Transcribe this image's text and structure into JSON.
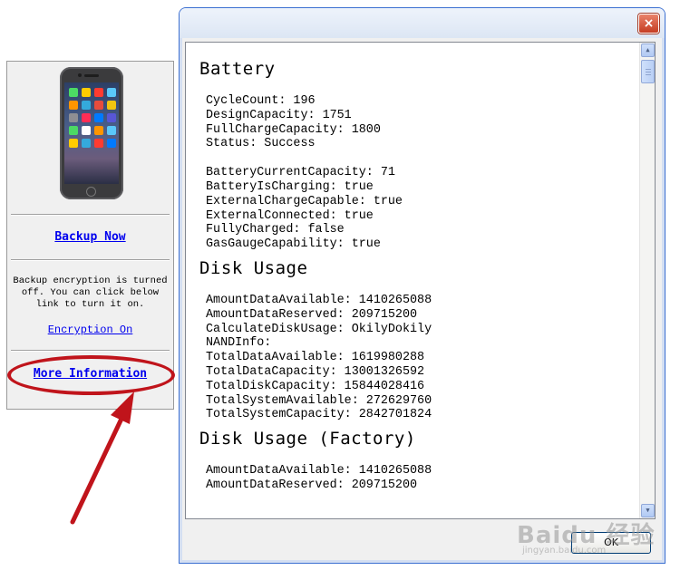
{
  "side_panel": {
    "backup_link": "Backup Now",
    "encryption_text": "Backup encryption is turned off. You can click below link to turn it on.",
    "encryption_link": "Encryption On",
    "more_info_link": "More Information"
  },
  "dialog": {
    "close_label": "×",
    "ok_label": "OK",
    "sections": [
      {
        "title": "Battery",
        "groups": [
          [
            "CycleCount: 196",
            "DesignCapacity: 1751",
            "FullChargeCapacity: 1800",
            "Status: Success"
          ],
          [
            "BatteryCurrentCapacity: 71",
            "BatteryIsCharging: true",
            "ExternalChargeCapable: true",
            "ExternalConnected: true",
            "FullyCharged: false",
            "GasGaugeCapability: true"
          ]
        ]
      },
      {
        "title": "Disk Usage",
        "groups": [
          [
            "AmountDataAvailable: 1410265088",
            "AmountDataReserved: 209715200",
            "CalculateDiskUsage: OkilyDokily",
            "NANDInfo:",
            "TotalDataAvailable: 1619980288",
            "TotalDataCapacity: 13001326592",
            "TotalDiskCapacity: 15844028416",
            "TotalSystemAvailable: 272629760",
            "TotalSystemCapacity: 2842701824"
          ]
        ]
      },
      {
        "title": "Disk Usage (Factory)",
        "groups": [
          [
            "AmountDataAvailable: 1410265088",
            "AmountDataReserved: 209715200"
          ]
        ]
      }
    ]
  },
  "watermark": {
    "main": "Baidu 经验",
    "sub": "jingyan.baidu.com"
  },
  "colors": {
    "link": "#0000ee",
    "annotation": "#c0141b",
    "close_button": "#c53d22"
  }
}
